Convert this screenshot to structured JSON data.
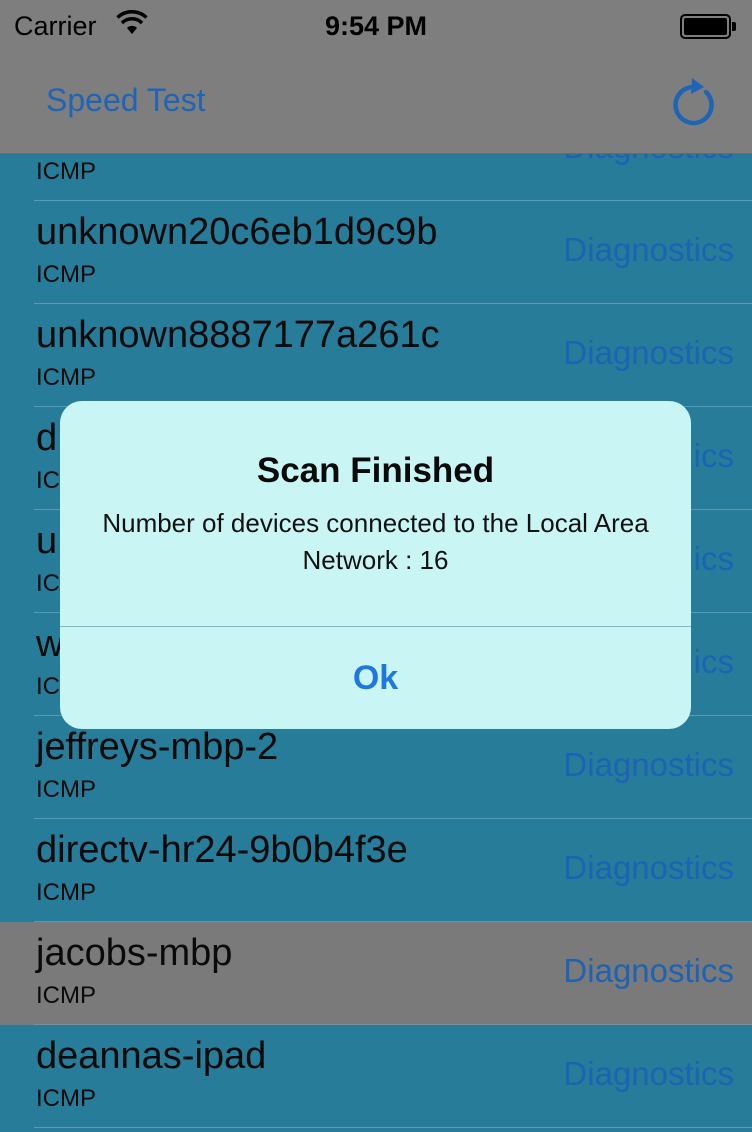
{
  "status_bar": {
    "carrier": "Carrier",
    "time": "9:54 PM"
  },
  "nav": {
    "left_button": "Speed Test",
    "right_icon": "refresh-icon"
  },
  "devices": [
    {
      "name": "",
      "protocol": "ICMP",
      "action": "Diagnostics"
    },
    {
      "name": "unknown20c6eb1d9c9b",
      "protocol": "ICMP",
      "action": "Diagnostics"
    },
    {
      "name": "unknown8887177a261c",
      "protocol": "ICMP",
      "action": "Diagnostics"
    },
    {
      "name": "d",
      "protocol": "IC",
      "action": "ics"
    },
    {
      "name": "u",
      "protocol": "IC",
      "action": "ics"
    },
    {
      "name": "w",
      "protocol": "IC",
      "action": "ics"
    },
    {
      "name": "jeffreys-mbp-2",
      "protocol": "ICMP",
      "action": "Diagnostics"
    },
    {
      "name": "directv-hr24-9b0b4f3e",
      "protocol": "ICMP",
      "action": "Diagnostics"
    },
    {
      "name": "jacobs-mbp",
      "protocol": "ICMP",
      "action": "Diagnostics"
    },
    {
      "name": "deannas-ipad",
      "protocol": "ICMP",
      "action": "Diagnostics"
    }
  ],
  "alert": {
    "title": "Scan Finished",
    "message": "Number of devices connected to the Local Area Network : 16",
    "button": "Ok"
  },
  "colors": {
    "list_background": "#277c99",
    "selected_row": "#7a7a7a",
    "accent": "#1d63b3",
    "alert_background": "#c9f6f5"
  }
}
